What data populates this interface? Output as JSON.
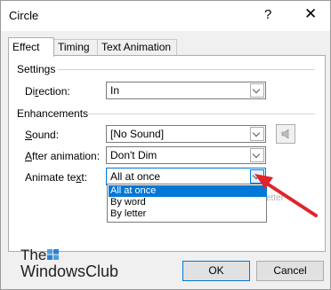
{
  "window": {
    "title": "Circle",
    "help_glyph": "?",
    "close_glyph": "✕"
  },
  "tabs": [
    {
      "label": "Effect",
      "active": true
    },
    {
      "label": "Timing",
      "active": false
    },
    {
      "label": "Text Animation",
      "active": false
    }
  ],
  "settings": {
    "heading": "Settings",
    "direction": {
      "label_pre": "Di",
      "label_key": "r",
      "label_post": "ection:",
      "value": "In"
    }
  },
  "enhancements": {
    "heading": "Enhancements",
    "sound": {
      "label_key": "S",
      "label_post": "ound:",
      "value": "[No Sound]"
    },
    "after_animation": {
      "label_key": "A",
      "label_post": "fter animation:",
      "value": "Don't Dim"
    },
    "animate_text": {
      "label_pre": "Animate te",
      "label_key": "x",
      "label_post": "t:",
      "value": "All at once",
      "options": [
        "All at once",
        "By word",
        "By letter"
      ],
      "selected_index": 0
    },
    "partially_visible_text": "etter"
  },
  "buttons": {
    "ok": "OK",
    "cancel": "Cancel"
  },
  "watermark": {
    "line1": "The",
    "line2": "WindowsClub"
  },
  "colors": {
    "accent": "#0078d7",
    "annotation_arrow": "#e0242b"
  },
  "icons": {
    "speaker": "speaker-icon",
    "close": "close-icon",
    "help": "help-icon"
  }
}
